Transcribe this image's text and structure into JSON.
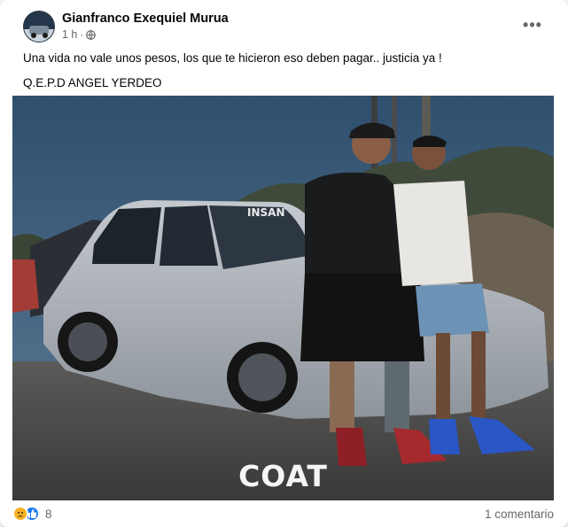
{
  "post": {
    "author": "Gianfranco Exequiel Murua",
    "time": "1 h",
    "separator": "·",
    "privacy_icon": "globe-icon",
    "more_icon": "more-options-icon",
    "more_label": "•••",
    "text_line1": "Una vida no vale unos pesos, los que te hicieron eso deben pagar.. justicia ya !",
    "text_line2": "Q.E.P.D ANGEL YERDEO"
  },
  "photo": {
    "description": "photo",
    "watermark": "COAT",
    "car_windshield_text": "INSAN"
  },
  "footer": {
    "reaction_icons": [
      "sad-reaction-icon",
      "like-reaction-icon"
    ],
    "reaction_count": "8",
    "comment_count": "1 comentario"
  },
  "colors": {
    "primary_text": "#050505",
    "secondary_text": "#65676b",
    "like_blue": "#1877f2",
    "sad_yellow": "#f7b125"
  }
}
